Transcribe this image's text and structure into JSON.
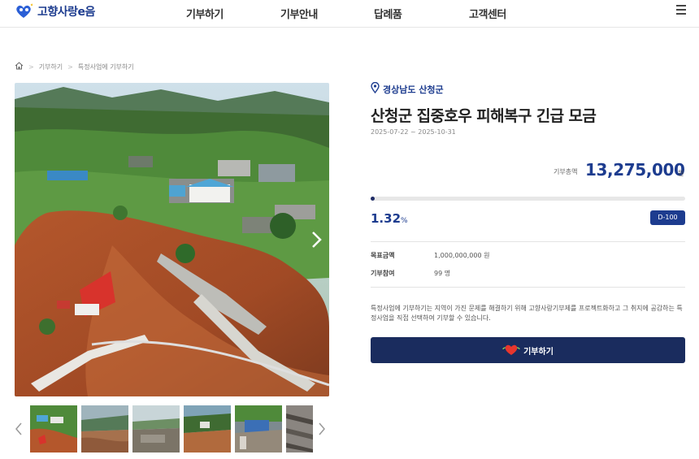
{
  "header": {
    "logo_text": "고향사랑e음",
    "nav": [
      "기부하기",
      "기부안내",
      "답례품",
      "고객센터"
    ]
  },
  "breadcrumb": {
    "items": [
      "기부하기",
      "특정사업에 기부하기"
    ]
  },
  "project": {
    "region": "경상남도 산청군",
    "title": "산청군 집중호우 피해복구 긴급 모금",
    "period": "2025-07-22 ~ 2025-10-31",
    "total_label": "기부총액",
    "total_amount": "13,275,000",
    "total_unit": "원",
    "percent_value": "1.32",
    "percent_unit": "%",
    "progress": 0.0132,
    "dday": "D-100",
    "goal_label": "목표금액",
    "goal_value": "1,000,000,000 원",
    "participants_label": "기부참여",
    "participants_value": "99 명",
    "description": "특정사업에 기부하기는 지역이 가진 문제를 해결하기 위해 고향사랑기부제를 프로젝트화하고 그 취지에 공감하는 특정사업을 직접 선택하여 기부할 수 있습니다.",
    "donate_label": "기부하기"
  },
  "colors": {
    "brand": "#1d3c8f",
    "button": "#1a2c5e",
    "heart": "#e8362d"
  },
  "icons": {
    "location": "location-pin-icon",
    "home": "home-icon",
    "menu": "hamburger-menu-icon",
    "heart": "heart-icon"
  }
}
